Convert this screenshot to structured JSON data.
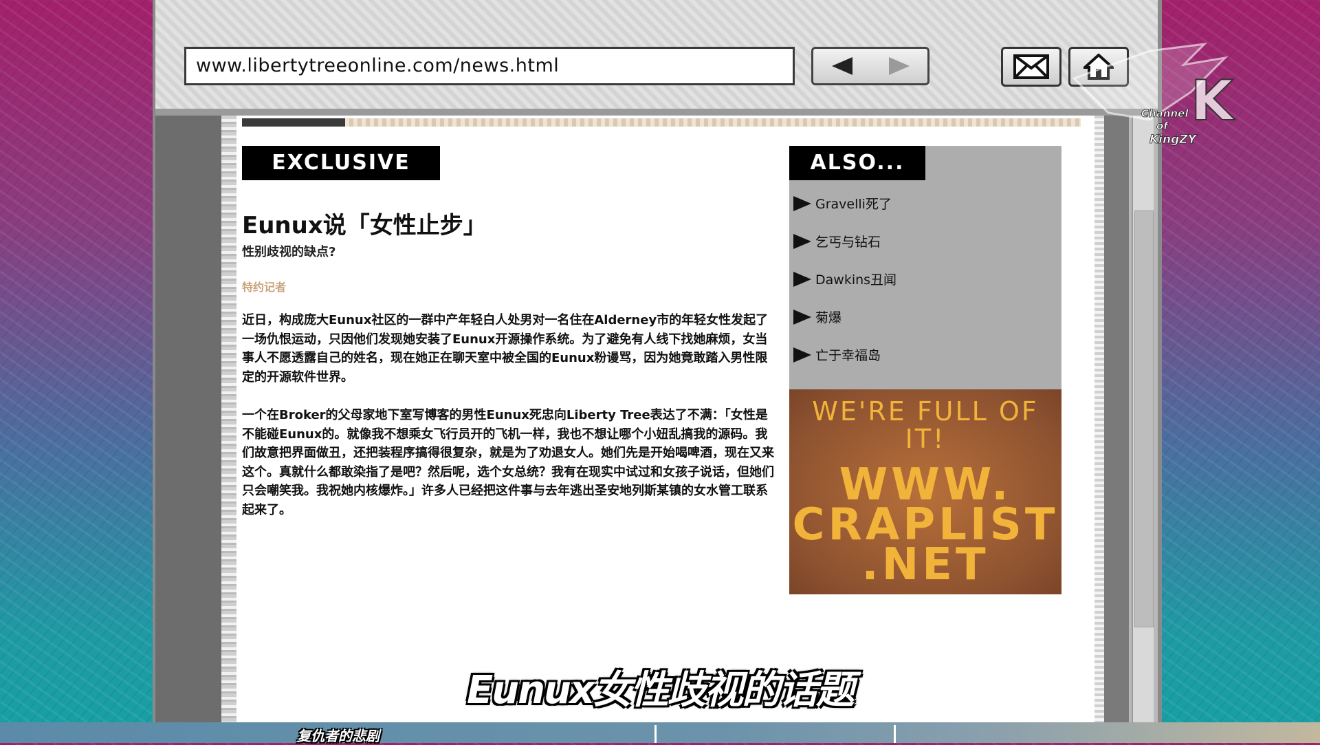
{
  "browser": {
    "url": "www.libertytreeonline.com/news.html",
    "icons": [
      "arrow-left-icon",
      "arrow-right-icon",
      "mail-icon",
      "home-icon"
    ]
  },
  "article": {
    "badge": "EXCLUSIVE",
    "title": "Eunux说「女性止步」",
    "subtitle": "性别歧视的缺点?",
    "byline": "特约记者",
    "paragraphs": [
      "近日，构成庞大Eunux社区的一群中产年轻白人处男对一名住在Alderney市的年轻女性发起了一场仇恨运动，只因他们发现她安装了Eunux开源操作系统。为了避免有人线下找她麻烦，女当事人不愿透露自己的姓名，现在她正在聊天室中被全国的Eunux粉谩骂，因为她竟敢踏入男性限定的开源软件世界。",
      "一个在Broker的父母家地下室写博客的男性Eunux死忠向Liberty Tree表达了不满：「女性是不能碰Eunux的。就像我不想乘女飞行员开的飞机一样，我也不想让哪个小妞乱搞我的源码。我们故意把界面做丑，还把装程序搞得很复杂，就是为了劝退女人。她们先是开始喝啤酒，现在又来这个。真就什么都敢染指了是吧？然后呢，选个女总统？我有在现实中试过和女孩子说话，但她们只会嘲笑我。我祝她内核爆炸。」许多人已经把这件事与去年逃出圣安地列斯某镇的女水管工联系起来了。"
    ]
  },
  "sidebar": {
    "badge": "ALSO...",
    "items": [
      "Gravelli死了",
      "乞丐与钻石",
      "Dawkins丑闻",
      "菊爆",
      "亡于幸福岛"
    ]
  },
  "ad": {
    "tagline": "WE'RE FULL OF IT!",
    "url_lines": [
      "WWW.",
      "CRAPLIST",
      ".NET"
    ]
  },
  "overlay": {
    "subtitle": "Eunux女性歧视的话题",
    "taskbar_label": "复仇者的悲剧",
    "watermark": {
      "line1": "Channel",
      "line2": "of",
      "line3": "KingZY",
      "letter": "K"
    }
  },
  "colors": {
    "byline": "#c9a27a",
    "ad_text": "#f2b33a",
    "ad_bg": "#8d5230",
    "sidebar_bg": "#adadad"
  }
}
